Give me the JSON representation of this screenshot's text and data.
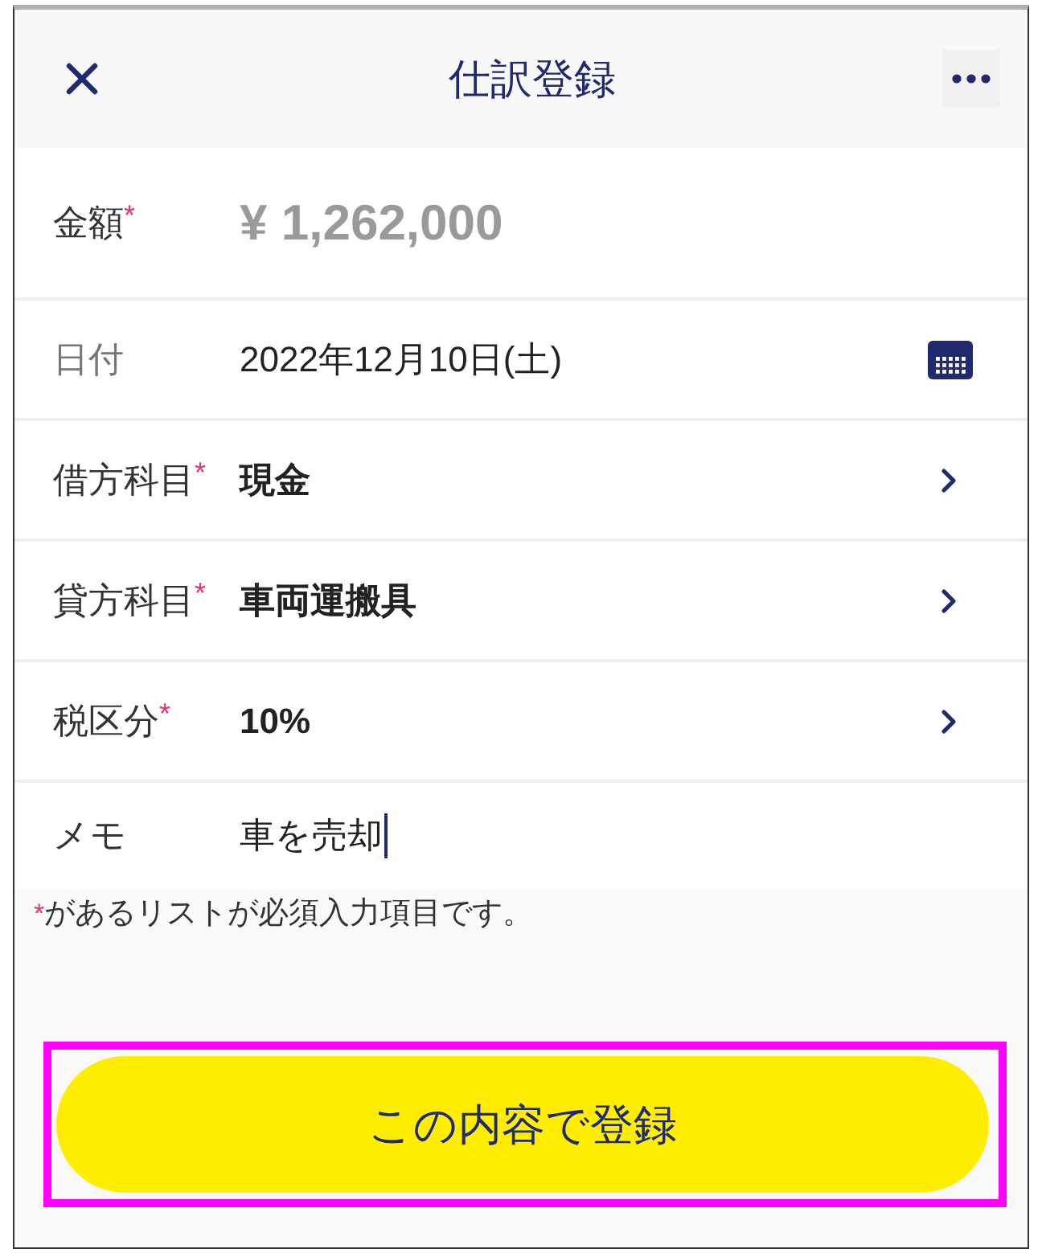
{
  "header": {
    "title": "仕訳登録"
  },
  "fields": [
    {
      "kind": "amount",
      "label": "金額",
      "mark": "*",
      "value": "¥ 1,262,000"
    },
    {
      "kind": "date",
      "label": "日付",
      "value": "2022年12月10日(土)"
    },
    {
      "kind": "select",
      "label": "借方科目",
      "mark": "*",
      "value": "現金"
    },
    {
      "kind": "select",
      "label": "貸方科目",
      "mark": "*",
      "value": "車両運搬具"
    },
    {
      "kind": "select",
      "label": "税区分",
      "mark": "*",
      "value": "10%"
    },
    {
      "kind": "text",
      "label": "メモ",
      "value": "車を売却",
      "focused": true
    }
  ],
  "note": {
    "mark": "*",
    "text": "があるリストが必須入力項目です。"
  },
  "submit_button": {
    "label": "この内容で登録",
    "highlighted": true
  }
}
